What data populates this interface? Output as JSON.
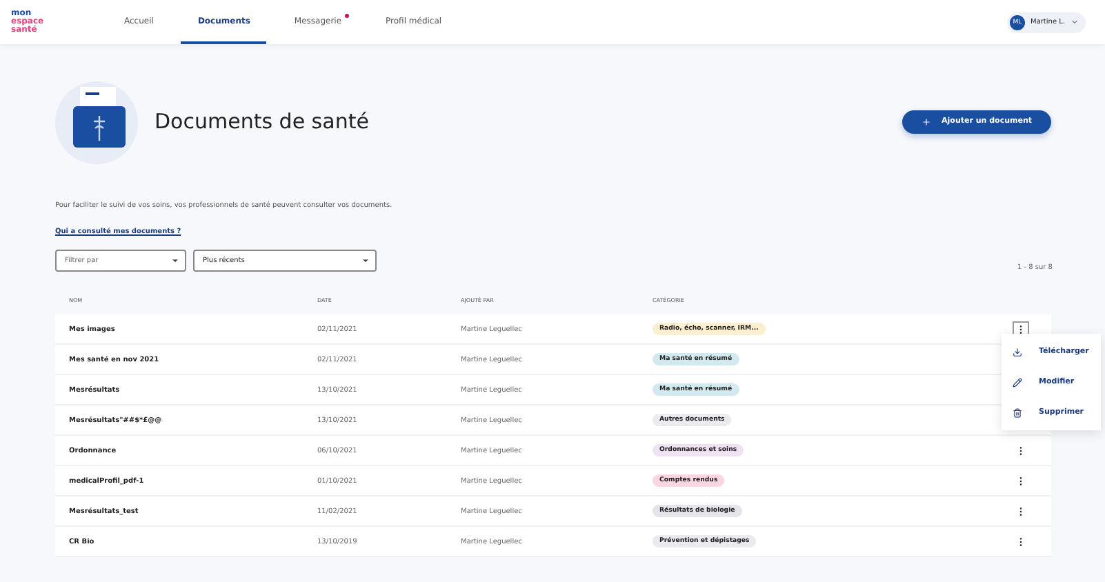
{
  "logo": [
    "mon",
    "espace",
    "santé"
  ],
  "nav": [
    {
      "label": "Accueil",
      "selected": false,
      "notification": false
    },
    {
      "label": "Documents",
      "selected": true,
      "notification": false
    },
    {
      "label": "Messagerie",
      "selected": false,
      "notification": true
    },
    {
      "label": "Profil médical",
      "selected": false,
      "notification": false
    }
  ],
  "user": {
    "initials": "ML",
    "name": "Martine L."
  },
  "title": "Documents de santé",
  "add_button": "Ajouter un document",
  "description": "Pour faciliter le suivi de vos soins, vos professionnels de santé peuvent consulter vos documents.",
  "link": "Qui a consulté mes documents ?",
  "filters": [
    {
      "placeholder": "Filtrer par"
    },
    {
      "value": "Plus récents"
    }
  ],
  "count": "1 - 8 sur 8",
  "table": {
    "columns": [
      "NOM",
      "DATE",
      "AJOUTÉ PAR",
      "CATÉGORIE"
    ],
    "rows": [
      {
        "name": "Mes images",
        "date": "02/11/2021",
        "added_by": "Martine Leguellec",
        "category": "Radio, écho, scanner, IRM...",
        "color": "#fbefcf",
        "actions_visible": true,
        "menu_open": true
      },
      {
        "name": "Mes santé en nov 2021",
        "date": "02/11/2021",
        "added_by": "Martine Leguellec",
        "category": "Ma santé en résumé",
        "color": "#d3e9f0",
        "actions_visible": false,
        "menu_open": false
      },
      {
        "name": "Mesrésultats",
        "date": "13/10/2021",
        "added_by": "Martine Leguellec",
        "category": "Ma santé en résumé",
        "color": "#d3e9f0",
        "actions_visible": false,
        "menu_open": false
      },
      {
        "name": "Mesrésultats\"##$*£@@",
        "date": "13/10/2021",
        "added_by": "Martine Leguellec",
        "category": "Autres documents",
        "color": "#ebebef",
        "actions_visible": false,
        "menu_open": false
      },
      {
        "name": "Ordonnance",
        "date": "06/10/2021",
        "added_by": "Martine Leguellec",
        "category": "Ordonnances et soins",
        "color": "#efe2f2",
        "actions_visible": true,
        "menu_open": false
      },
      {
        "name": "medicalProfil_pdf-1",
        "date": "01/10/2021",
        "added_by": "Martine Leguellec",
        "category": "Comptes rendus",
        "color": "#f9d6e1",
        "actions_visible": true,
        "menu_open": false
      },
      {
        "name": "Mesrésultats_test",
        "date": "11/02/2021",
        "added_by": "Martine Leguellec",
        "category": "Résultats de biologie",
        "color": "#e4e4ea",
        "actions_visible": true,
        "menu_open": false
      },
      {
        "name": "CR Bio",
        "date": "13/10/2019",
        "added_by": "Martine Leguellec",
        "category": "Prévention et dépistages",
        "color": "#ebebef",
        "actions_visible": true,
        "menu_open": false
      }
    ]
  },
  "menu": [
    {
      "kind": "download",
      "label": "Télécharger"
    },
    {
      "kind": "edit",
      "label": "Modifier"
    },
    {
      "kind": "delete",
      "label": "Supprimer"
    }
  ]
}
